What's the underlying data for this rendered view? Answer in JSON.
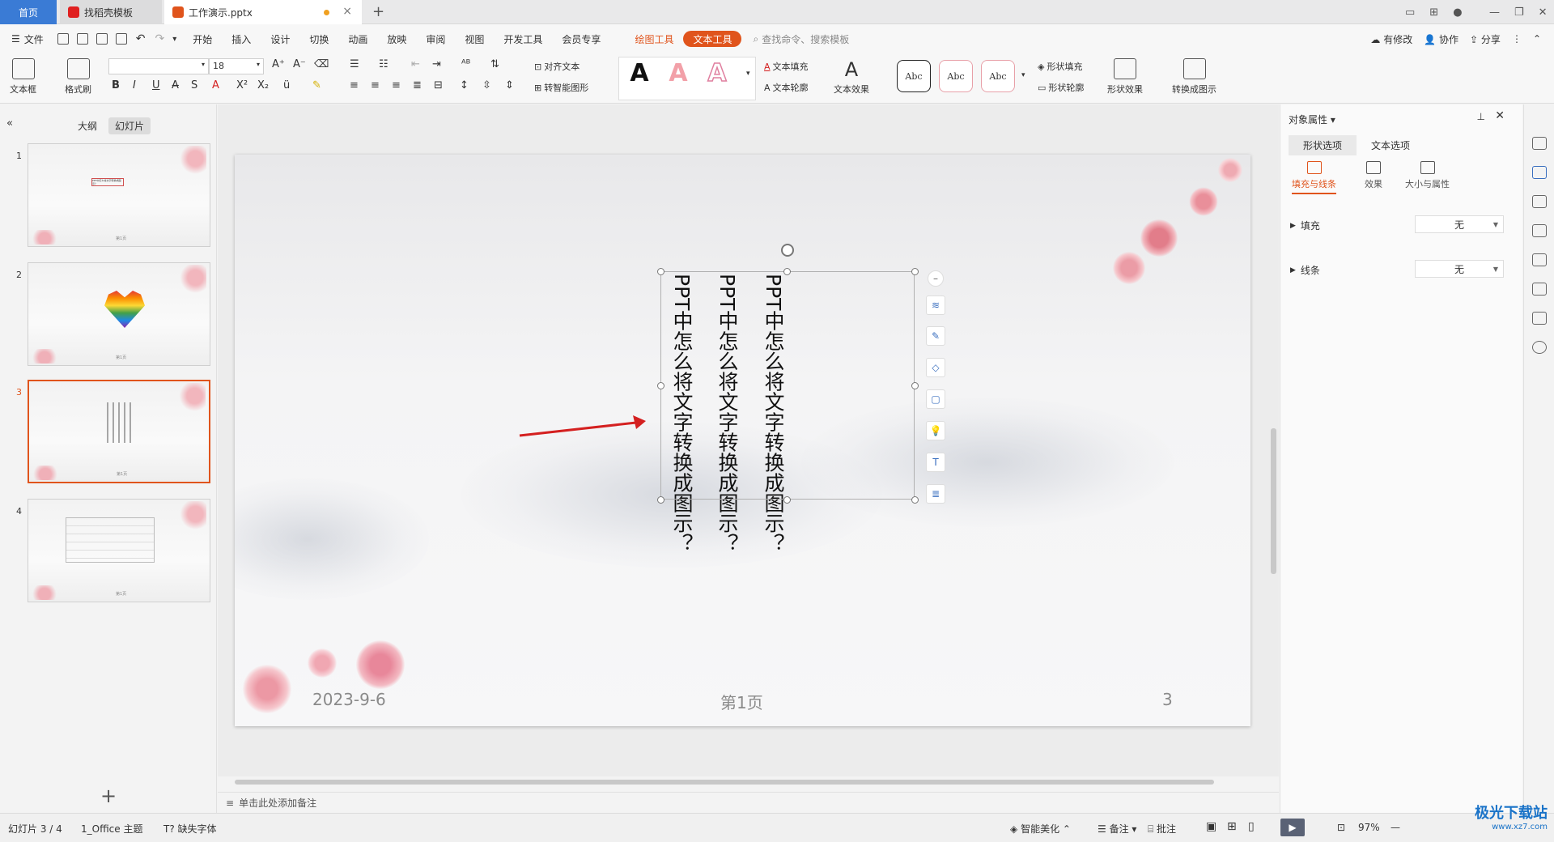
{
  "tabs": {
    "home": "首页",
    "template": "找稻壳模板",
    "file": "工作演示.pptx"
  },
  "menu": {
    "file": "文件",
    "items": [
      "开始",
      "插入",
      "设计",
      "切换",
      "动画",
      "放映",
      "审阅",
      "视图",
      "开发工具",
      "会员专享"
    ],
    "draw_tools": "绘图工具",
    "text_tools": "文本工具",
    "search_placeholder": "查找命令、搜索模板",
    "has_changes": "有修改",
    "collaborate": "协作",
    "share": "分享"
  },
  "ribbon": {
    "textbox": "文本框",
    "format_painter": "格式刷",
    "font_size": "18",
    "align_text": "对齐文本",
    "smart_shape": "转智能图形",
    "text_fill": "文本填充",
    "text_outline": "文本轮廓",
    "text_effect": "文本效果",
    "style_sample": "Abc",
    "shape_fill": "形状填充",
    "shape_outline": "形状轮廓",
    "shape_effect": "形状效果",
    "convert_diagram": "转换成图示",
    "wordart_letter": "A"
  },
  "left_panel": {
    "outline_tab": "大纲",
    "slides_tab": "幻灯片",
    "slide_numbers": [
      "1",
      "2",
      "3",
      "4"
    ],
    "slide1_title": "PPT中怎么将文字转换成图示？",
    "thumb_page": "第1页"
  },
  "slide": {
    "col1": "PPT中怎么将文字转换成图示？",
    "col2": "PPT中怎么将文字转换成图示？",
    "col3": "PPT中怎么将文字转换成图示？",
    "date": "2023-9-6",
    "page_label": "第1页",
    "number": "3"
  },
  "notes_placeholder": "单击此处添加备注",
  "right_panel": {
    "title": "对象属性",
    "tab_shape": "形状选项",
    "tab_text": "文本选项",
    "sub_fill": "填充与线条",
    "sub_effect": "效果",
    "sub_size": "大小与属性",
    "fill_label": "填充",
    "fill_value": "无",
    "line_label": "线条",
    "line_value": "无"
  },
  "status": {
    "slide_count": "幻灯片 3 / 4",
    "theme": "1_Office 主题",
    "missing_font": "缺失字体",
    "smart_beautify": "智能美化",
    "notes": "备注",
    "comments": "批注",
    "zoom": "97%"
  },
  "watermark": {
    "brand": "极光下载站",
    "url": "www.xz7.com"
  },
  "colors": {
    "accent": "#e0541c",
    "home_tab": "#3a7bd5",
    "arrow": "#d42020"
  }
}
